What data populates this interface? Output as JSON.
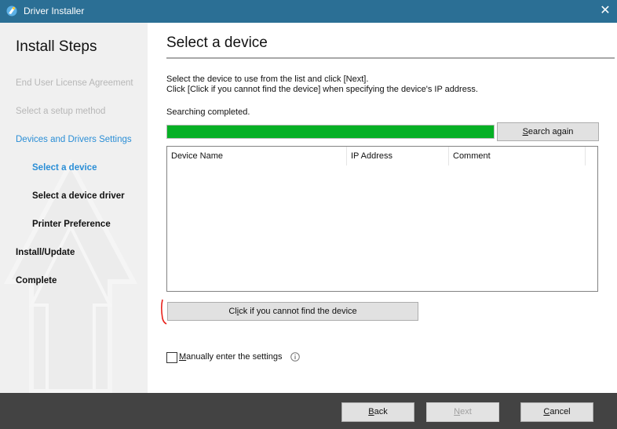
{
  "window": {
    "title": "Driver Installer",
    "close_icon": "close-icon",
    "app_icon": "driver-installer-icon"
  },
  "sidebar": {
    "title": "Install Steps",
    "steps": [
      {
        "label": "End User License Agreement",
        "state": "done"
      },
      {
        "label": "Select a setup method",
        "state": "done"
      },
      {
        "label": "Devices and Drivers Settings",
        "state": "group"
      },
      {
        "label": "Select a device",
        "state": "current"
      },
      {
        "label": "Select a device driver",
        "state": "pending"
      },
      {
        "label": "Printer Preference",
        "state": "pending"
      },
      {
        "label": "Install/Update",
        "state": "pending"
      },
      {
        "label": "Complete",
        "state": "pending"
      }
    ]
  },
  "main": {
    "title": "Select a device",
    "instructions": [
      "Select the device to use from the list and click [Next].",
      "Click [Click if you cannot find the device] when specifying the device's IP address."
    ],
    "status": "Searching completed.",
    "progress_percent": 100,
    "progress_color": "#06b025",
    "search_again_label": "Search again",
    "search_again_mnemonic": "S",
    "table": {
      "columns": [
        "Device Name",
        "IP Address",
        "Comment"
      ],
      "rows": []
    },
    "find_device_label": "Click if you cannot find the device",
    "find_device_mnemonic": "i",
    "manual_label": "Manually enter the settings",
    "manual_mnemonic": "M",
    "manual_checked": false,
    "info_icon": "info-icon"
  },
  "footer": {
    "back_label": "Back",
    "back_mnemonic": "B",
    "next_label": "Next",
    "next_mnemonic": "N",
    "next_enabled": false,
    "cancel_label": "Cancel",
    "cancel_mnemonic": "C"
  },
  "colors": {
    "titlebar": "#2b6f95",
    "accent": "#2a8ed6",
    "footer": "#434343",
    "sidebar": "#f0f0f0"
  }
}
